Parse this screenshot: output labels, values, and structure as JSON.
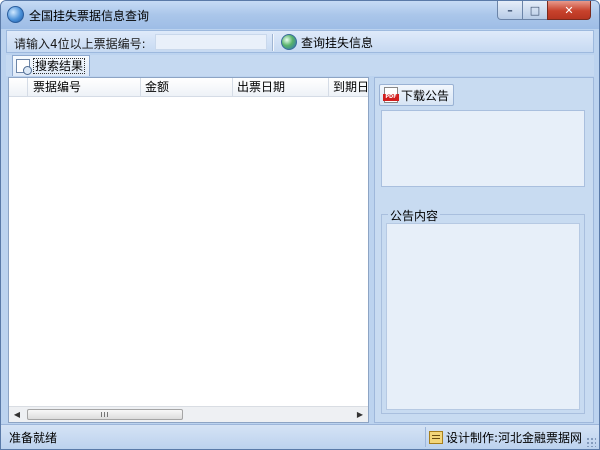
{
  "window": {
    "title": "全国挂失票据信息查询",
    "min_glyph": "–",
    "max_glyph": "□",
    "close_glyph": "✕"
  },
  "toolbar": {
    "input_label": "请输入4位以上票据编号:",
    "input_value": "",
    "query_button": "查询挂失信息"
  },
  "tabs": [
    {
      "label": "搜索结果",
      "active": true
    }
  ],
  "grid": {
    "columns": [
      "票据编号",
      "金额",
      "出票日期",
      "到期日"
    ],
    "rows": [],
    "scroll_thumb_glyph": "III",
    "scroll_left_glyph": "◀",
    "scroll_right_glyph": "▶"
  },
  "right_panel": {
    "download_button": "下载公告",
    "content_group_label": "公告内容"
  },
  "status": {
    "left_text": "准备就绪",
    "right_text": "设计制作:河北金融票据网"
  },
  "colors": {
    "window_bg": "#bcd3ef",
    "close_button": "#c7422c",
    "panel_bg": "#c8dbf1"
  }
}
